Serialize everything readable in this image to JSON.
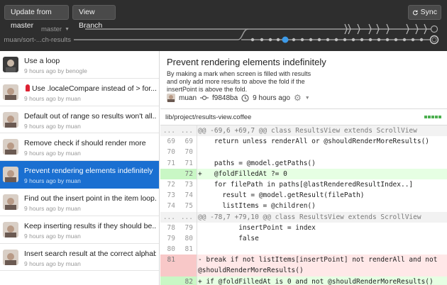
{
  "toolbar": {
    "update_label": "Update from master",
    "view_branch_label": "View Branch",
    "sync_label": "Sync"
  },
  "branches": {
    "master": "master",
    "feature": "muan/sort-...ch-results"
  },
  "commits": [
    {
      "title": "Use a loop",
      "meta": "9 hours ago by benogle"
    },
    {
      "title": "Use .localeCompare instead of > for...",
      "meta": "9 hours ago by muan"
    },
    {
      "title": "Default out of range so results won't all...",
      "meta": "9 hours ago by muan"
    },
    {
      "title": "Remove check if should render more",
      "meta": "9 hours ago by muan"
    },
    {
      "title": "Prevent rendering elements indefinitely",
      "meta": "9 hours ago by muan"
    },
    {
      "title": "Find out the insert point in the item loop...",
      "meta": "9 hours ago by muan"
    },
    {
      "title": "Keep inserting results if they should be...",
      "meta": "9 hours ago by muan"
    },
    {
      "title": "Insert search result at the correct alphab...",
      "meta": "9 hours ago by muan"
    }
  ],
  "detail": {
    "title": "Prevent rendering elements indefinitely",
    "description": "By making a mark when screen is filled with results and only add more results to above the fold if the insertPoint is above the fold.",
    "author": "muan",
    "sha": "f9848ba",
    "time": "9 hours ago",
    "file_path": "lib/project/results-view.coffee"
  },
  "diff": [
    {
      "type": "hunk",
      "old": "...",
      "new": "...",
      "code": "@@ -69,6 +69,7 @@ class ResultsView extends ScrollView"
    },
    {
      "type": "ctx",
      "old": "69",
      "new": "69",
      "code": "    return unless renderAll or @shouldRenderMoreResults()"
    },
    {
      "type": "ctx",
      "old": "70",
      "new": "70",
      "code": ""
    },
    {
      "type": "ctx",
      "old": "71",
      "new": "71",
      "code": "    paths = @model.getPaths()"
    },
    {
      "type": "add",
      "old": "",
      "new": "72",
      "code": "+   @foldFilledAt ?= 0"
    },
    {
      "type": "ctx",
      "old": "72",
      "new": "73",
      "code": "    for filePath in paths[@lastRenderedResultIndex..]"
    },
    {
      "type": "ctx",
      "old": "73",
      "new": "74",
      "code": "      result = @model.getResult(filePath)"
    },
    {
      "type": "ctx",
      "old": "74",
      "new": "75",
      "code": "      listItems = @children()"
    },
    {
      "type": "hunk",
      "old": "...",
      "new": "...",
      "code": "@@ -78,7 +79,10 @@ class ResultsView extends ScrollView"
    },
    {
      "type": "ctx",
      "old": "78",
      "new": "79",
      "code": "          insertPoint = index"
    },
    {
      "type": "ctx",
      "old": "79",
      "new": "80",
      "code": "          false"
    },
    {
      "type": "ctx",
      "old": "80",
      "new": "81",
      "code": ""
    },
    {
      "type": "del",
      "old": "81",
      "new": "",
      "code": "-       break if not listItems[insertPoint] not renderAll and not @shouldRenderMoreResults()"
    },
    {
      "type": "add",
      "old": "",
      "new": "82",
      "code": "+       if @foldFilledAt is 0 and not @shouldRenderMoreResults()"
    }
  ],
  "colors": {
    "topbar": "#2e2e2e",
    "selected": "#1a6fd1",
    "graph_line": "#9a9a9a",
    "current_commit": "#3d9be9"
  }
}
